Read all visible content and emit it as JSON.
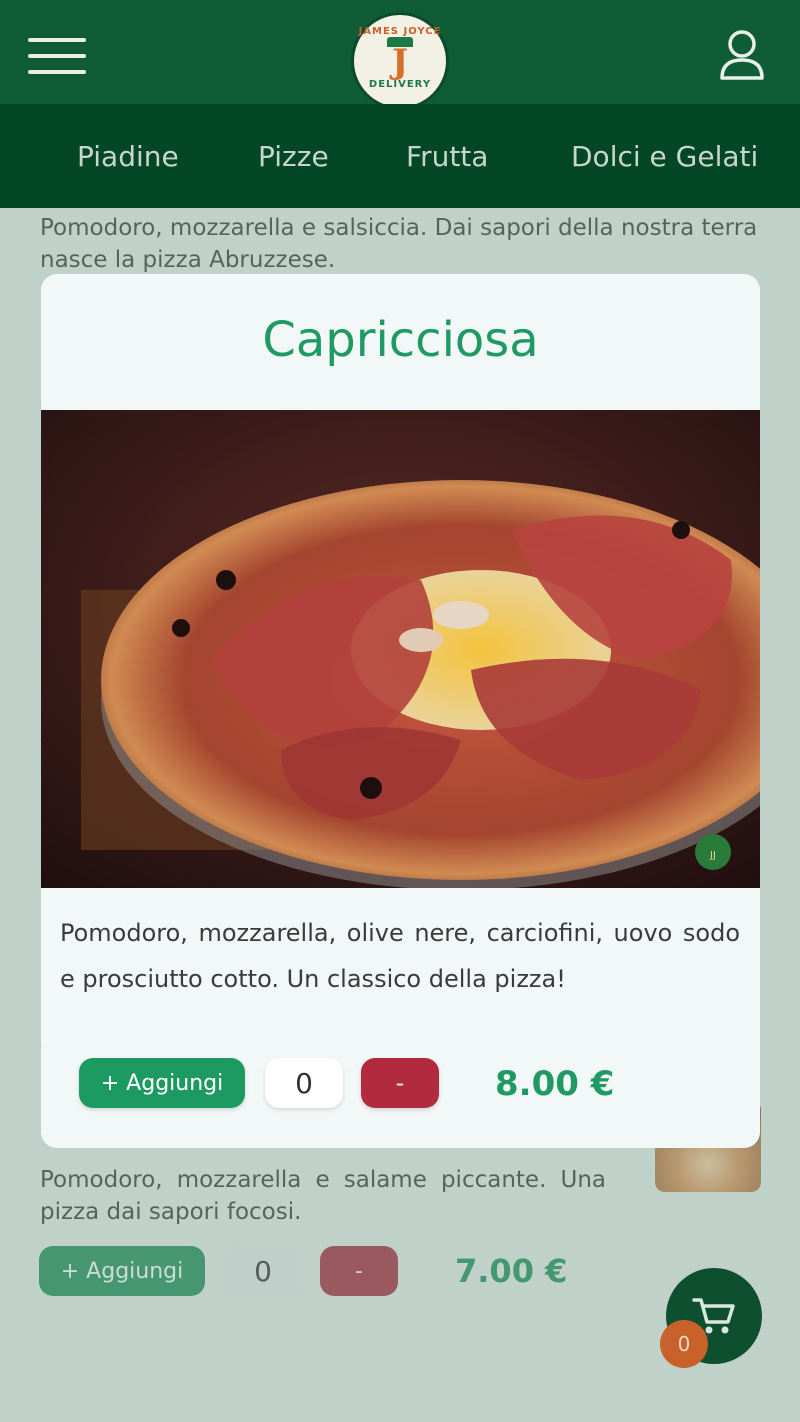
{
  "header": {
    "logo": {
      "top_text": "JAMES JOYCE",
      "letter": "J",
      "bottom_text": "DELIVERY"
    },
    "menu_icon": "hamburger-icon",
    "user_icon": "user-icon"
  },
  "tabs": [
    {
      "label": "Piadine"
    },
    {
      "label": "Pizze"
    },
    {
      "label": "Frutta"
    },
    {
      "label": "Dolci e Gelati"
    }
  ],
  "background_list": {
    "item_top_desc": "Pomodoro, mozzarella e salsiccia. Dai sapori della nostra terra nasce la pizza Abruzzese.",
    "item_bottom": {
      "desc": "Pomodoro, mozzarella e salame piccante. Una pizza dai sapori focosi.",
      "add_label": "+ Aggiungi",
      "qty": "0",
      "minus_label": "-",
      "price": "7.00 €"
    }
  },
  "cart": {
    "icon": "cart-icon",
    "count": "0"
  },
  "modal": {
    "title": "Capricciosa",
    "description": "Pomodoro, mozzarella, olive nere, carciofini, uovo sodo e prosciutto cotto. Un classico della pizza!",
    "add_label": "+ Aggiungi",
    "qty": "0",
    "minus_label": "-",
    "price": "8.00 €"
  },
  "colors": {
    "header_green": "#0f5c37",
    "tabbar_green": "#024626",
    "accent_green": "#1f9a62",
    "minus_red": "#b12a3e",
    "badge_orange": "#c8612a"
  }
}
